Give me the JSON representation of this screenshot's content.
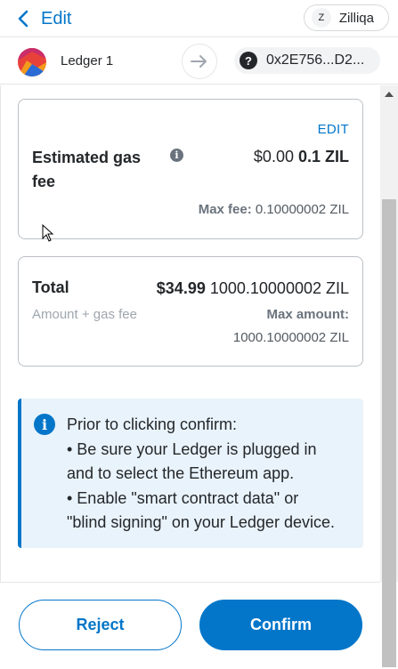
{
  "header": {
    "back_label": "Edit",
    "network": {
      "avatar_letter": "Z",
      "name": "Zilliqa"
    }
  },
  "account_row": {
    "from_name": "Ledger 1",
    "to_icon_glyph": "?",
    "to_address": "0x2E756...D2..."
  },
  "gas_card": {
    "edit_label": "EDIT",
    "label": "Estimated gas fee",
    "info_glyph": "i",
    "fiat": "$0.00",
    "native": "0.1 ZIL",
    "max_fee_label": "Max fee:",
    "max_fee_value": "0.10000002 ZIL"
  },
  "total_card": {
    "label": "Total",
    "fiat": "$34.99",
    "native": "1000.10000002 ZIL",
    "sub_label": "Amount + gas fee",
    "max_amount_label": "Max amount:",
    "max_amount_value": "1000.10000002 ZIL"
  },
  "banner": {
    "icon_glyph": "i",
    "lines": [
      "Prior to clicking confirm:",
      "• Be sure your Ledger is plugged in",
      "and to select the Ethereum app.",
      "• Enable \"smart contract data\" or",
      "\"blind signing\" on your Ledger device."
    ]
  },
  "footer": {
    "reject_label": "Reject",
    "confirm_label": "Confirm"
  },
  "colors": {
    "primary": "#0376c9",
    "banner_bg": "#e9f3fb",
    "text": "#24272a",
    "muted": "#9fa6ae",
    "border": "#bbc0c5"
  }
}
